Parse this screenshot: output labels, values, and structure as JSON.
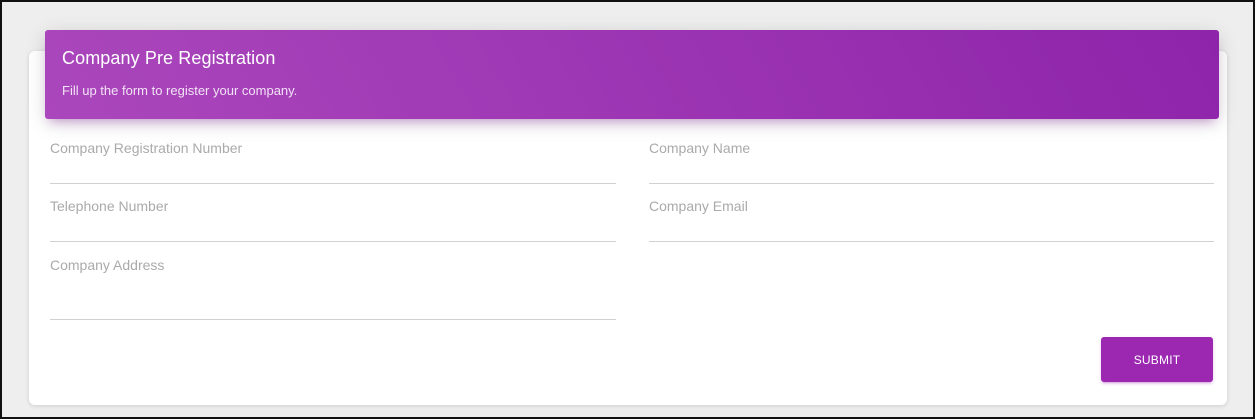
{
  "header": {
    "title": "Company Pre Registration",
    "subtitle": "Fill up the form to register your company."
  },
  "form": {
    "fields": [
      {
        "label": "Company Registration Number",
        "value": ""
      },
      {
        "label": "Company Name",
        "value": ""
      },
      {
        "label": "Telephone Number",
        "value": ""
      },
      {
        "label": "Company Email",
        "value": ""
      },
      {
        "label": "Company Address",
        "value": ""
      }
    ],
    "submit_label": "SUBMIT"
  },
  "colors": {
    "accent": "#9c27b0",
    "header_gradient_start": "#ab47bc",
    "header_gradient_end": "#8e24aa",
    "label": "#aaaaaa",
    "underline": "#d2d2d2",
    "background": "#eeeeee"
  }
}
